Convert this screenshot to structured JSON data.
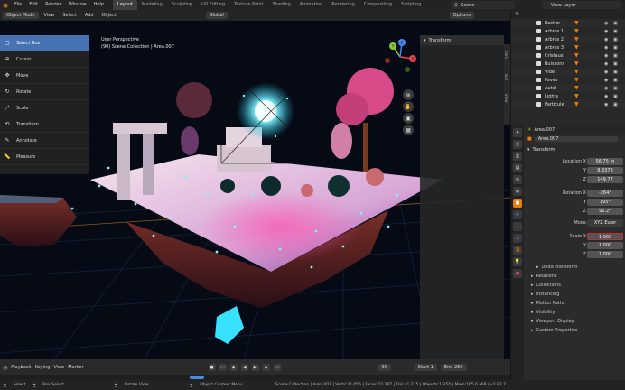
{
  "menu": [
    "File",
    "Edit",
    "Render",
    "Window",
    "Help"
  ],
  "workspaces": [
    "Layout",
    "Modeling",
    "Sculpting",
    "UV Editing",
    "Texture Paint",
    "Shading",
    "Animation",
    "Rendering",
    "Compositing",
    "Scripting"
  ],
  "scene": "Scene",
  "view_layer": "View Layer",
  "viewport": {
    "mode": "Object Mode",
    "menus": [
      "View",
      "Select",
      "Add",
      "Object"
    ],
    "transform_orientation": "Global",
    "options": "Options",
    "perspective": "User Perspective",
    "collection_path": "(90) Scene Collection | Area.007"
  },
  "tools": [
    {
      "label": "Select Box",
      "icon": "▢"
    },
    {
      "label": "Cursor",
      "icon": "⊕"
    },
    {
      "label": "Move",
      "icon": "✥"
    },
    {
      "label": "Rotate",
      "icon": "↻"
    },
    {
      "label": "Scale",
      "icon": "⤢"
    },
    {
      "label": "Transform",
      "icon": "⟲"
    },
    {
      "label": "Annotate",
      "icon": "✎"
    },
    {
      "label": "Measure",
      "icon": "📏"
    }
  ],
  "n_panel": {
    "header": "Transform",
    "tabs": [
      "Item",
      "Tool",
      "View"
    ]
  },
  "gizmo": {
    "x": "X",
    "y": "Y",
    "z": "Z"
  },
  "outliner_items": [
    "Rocher",
    "Arbres 1",
    "Arbres 2",
    "Arbres 3",
    "Cristaux",
    "Buissons",
    "Vide",
    "Pavés",
    "Autel",
    "Lights",
    "Particule"
  ],
  "properties": {
    "object_name": "Area.007",
    "data_name": "Area.007",
    "transform_header": "Transform",
    "location": {
      "label": "Location X",
      "x": "56.75 m",
      "y": "8.3373",
      "z": "149.77"
    },
    "rotation": {
      "label": "Rotation X",
      "x": "-264°",
      "y": "195°",
      "z": "91.2°"
    },
    "mode": {
      "label": "Mode",
      "value": "XYZ Euler"
    },
    "scale": {
      "label": "Scale X",
      "x": "1.000",
      "y": "1.000",
      "z": "1.000"
    },
    "axis_y": "Y",
    "axis_z": "Z",
    "sections": [
      "Delta Transform",
      "Relations",
      "Collections",
      "Instancing",
      "Motion Paths",
      "Visibility",
      "Viewport Display",
      "Custom Properties"
    ]
  },
  "timeline": {
    "menus": [
      "Playback",
      "Keying",
      "View",
      "Marker"
    ],
    "current_frame": "90",
    "start_label": "Start",
    "start": "1",
    "end_label": "End",
    "end": "250"
  },
  "status": [
    "Select",
    "Box Select",
    "Rotate View",
    "Object Context Menu",
    "Scene Collection | Area.007 | Verts:21,056 | Faces:22,347 | Tris:41,275 | Objects:1/350 | Mem:165.6 MiB | v2.82.7"
  ],
  "colors": {
    "accent": "#4772b3",
    "orange": "#e87d0d",
    "scale_highlight": "#c43030"
  }
}
